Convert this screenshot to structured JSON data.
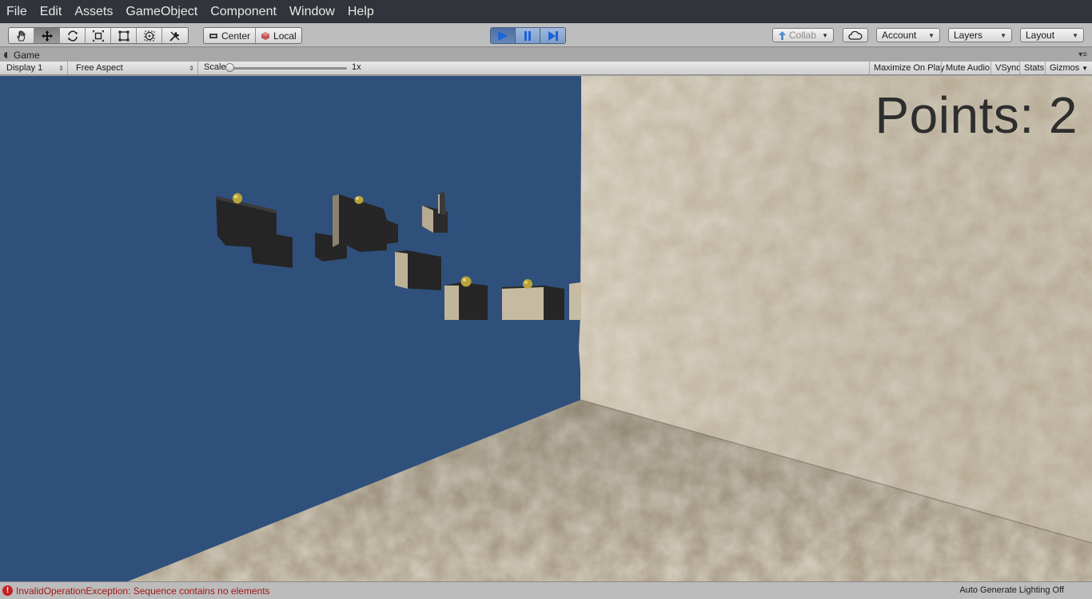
{
  "menubar": {
    "items": [
      "File",
      "Edit",
      "Assets",
      "GameObject",
      "Component",
      "Window",
      "Help"
    ]
  },
  "toolbar": {
    "transform_tools": [
      {
        "icon": "hand-icon",
        "name": "hand-tool"
      },
      {
        "icon": "move-icon",
        "name": "move-tool"
      },
      {
        "icon": "rotate-icon",
        "name": "rotate-tool"
      },
      {
        "icon": "scale-icon",
        "name": "scale-tool"
      },
      {
        "icon": "rect-icon",
        "name": "rect-tool"
      },
      {
        "icon": "transform-icon",
        "name": "transform-tool"
      },
      {
        "icon": "custom-tools-icon",
        "name": "custom-tool"
      }
    ],
    "pivot_label": "Center",
    "space_label": "Local",
    "collab_label": "Collab",
    "account_label": "Account",
    "layers_label": "Layers",
    "layout_label": "Layout"
  },
  "game_tab": {
    "label": "Game"
  },
  "game_bar": {
    "display": "Display 1",
    "aspect": "Free Aspect",
    "scale_label": "Scale",
    "scale_value": "1x",
    "maximize": "Maximize On Play",
    "mute": "Mute Audio",
    "vsync": "VSync",
    "stats": "Stats",
    "gizmos": "Gizmos"
  },
  "game_view": {
    "points_text": "Points: 2"
  },
  "status_bar": {
    "error": "InvalidOperationException: Sequence contains no elements",
    "lighting": "Auto Generate Lighting Off"
  },
  "colors": {
    "sky": "#30507c",
    "wall": "#bfb39b",
    "dark_block": "#262626",
    "coin": "#b8a43a"
  }
}
